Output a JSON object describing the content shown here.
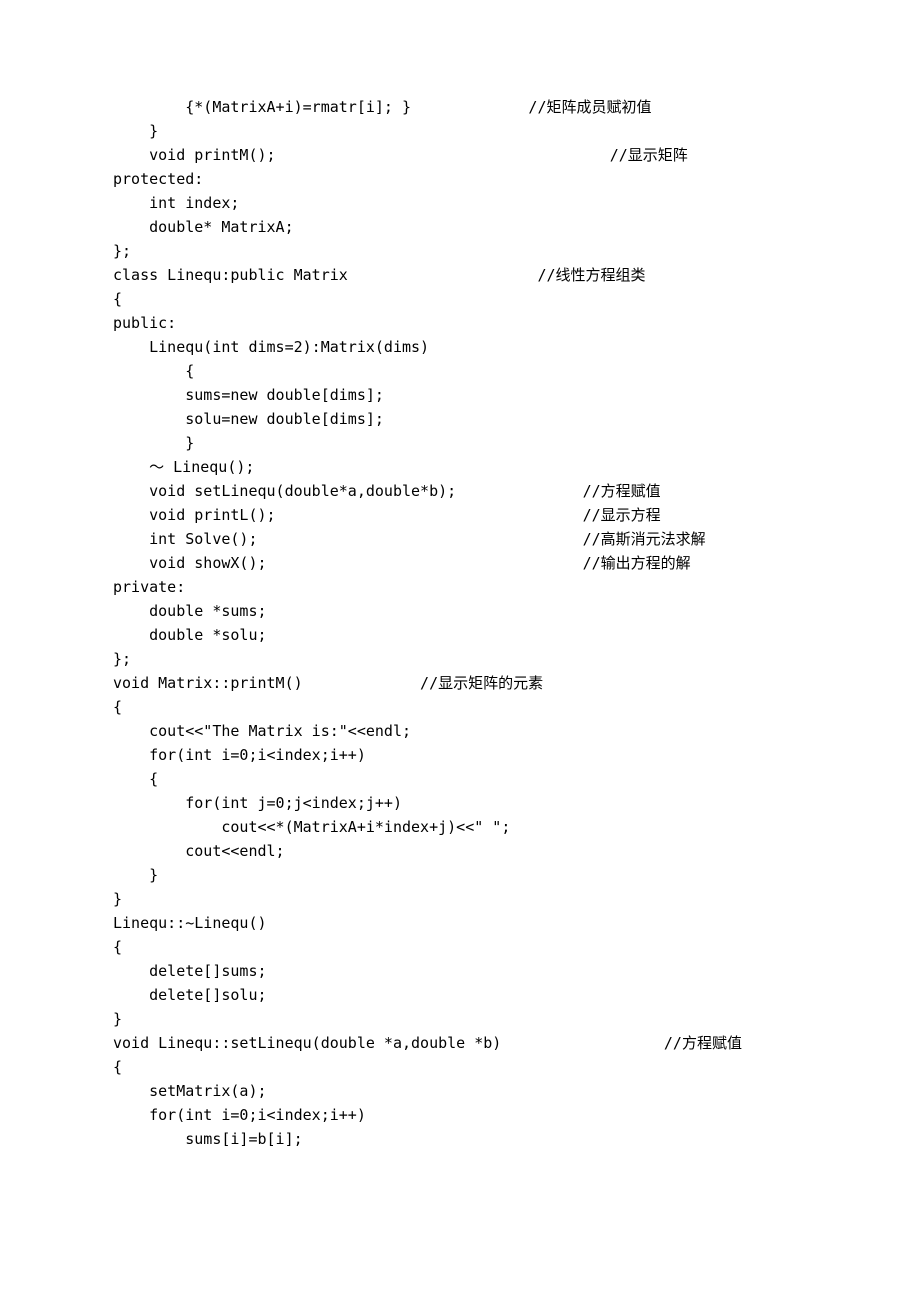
{
  "lines": [
    "        {*(MatrixA+i)=rmatr[i]; }             //矩阵成员赋初值",
    "    }",
    "    void printM();                                     //显示矩阵",
    "protected:",
    "    int index;",
    "    double* MatrixA;",
    "};",
    "class Linequ:public Matrix                     //线性方程组类",
    "{",
    "public:",
    "    Linequ(int dims=2):Matrix(dims)",
    "        {",
    "        sums=new double[dims];",
    "        solu=new double[dims];",
    "        }",
    "    ～ Linequ();",
    "    void setLinequ(double*a,double*b);              //方程赋值",
    "    void printL();                                  //显示方程",
    "    int Solve();                                    //高斯消元法求解",
    "    void showX();                                   //输出方程的解",
    "private:",
    "    double *sums;",
    "    double *solu;",
    "};",
    "void Matrix::printM()             //显示矩阵的元素",
    "{",
    "    cout<<\"The Matrix is:\"<<endl;",
    "    for(int i=0;i<index;i++)",
    "    {",
    "        for(int j=0;j<index;j++)",
    "            cout<<*(MatrixA+i*index+j)<<\" \";",
    "        cout<<endl;",
    "    }",
    "}",
    "Linequ::~Linequ()",
    "{",
    "    delete[]sums;",
    "    delete[]solu;",
    "}",
    "void Linequ::setLinequ(double *a,double *b)                  //方程赋值",
    "{",
    "    setMatrix(a);",
    "    for(int i=0;i<index;i++)",
    "        sums[i]=b[i];"
  ]
}
